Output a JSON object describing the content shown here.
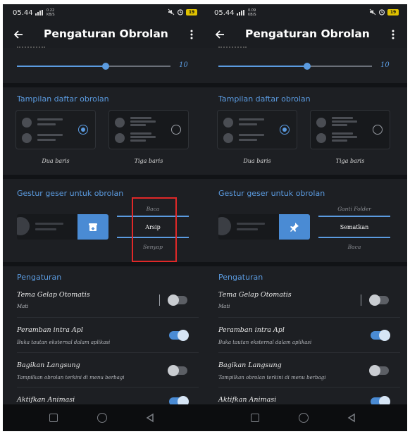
{
  "screens": [
    {
      "status": {
        "time": "05.44",
        "speed": "0.22\nKB/S",
        "battery": "19"
      },
      "title": "Pengaturan Obrolan",
      "slider_value": "10",
      "slider_level": 0.58,
      "list_section": {
        "title": "Tampilan daftar obrolan",
        "options": [
          {
            "label": "Dua baris",
            "selected": true
          },
          {
            "label": "Tiga baris",
            "selected": false
          }
        ]
      },
      "swipe_section": {
        "title": "Gestur geser untuk obrolan",
        "picker": [
          "Baca",
          "Arsip",
          "Senyap"
        ],
        "action_icon": "archive-icon"
      },
      "settings_section": {
        "title": "Pengaturan",
        "items": [
          {
            "title": "Tema Gelap Otomatis",
            "sub": "Mati",
            "on": false
          },
          {
            "title": "Peramban intra Apl",
            "sub": "Buka tautan eksternal dalam aplikasi",
            "on": true
          },
          {
            "title": "Bagikan Langsung",
            "sub": "Tampilkan obrolan terkini di menu berbagi",
            "on": false
          },
          {
            "title": "Aktifkan Animasi",
            "sub": "",
            "on": true
          }
        ]
      }
    },
    {
      "status": {
        "time": "05.44",
        "speed": "0.09\nKB/S",
        "battery": "19"
      },
      "title": "Pengaturan Obrolan",
      "slider_value": "10",
      "slider_level": 0.58,
      "list_section": {
        "title": "Tampilan daftar obrolan",
        "options": [
          {
            "label": "Dua baris",
            "selected": true
          },
          {
            "label": "Tiga baris",
            "selected": false
          }
        ]
      },
      "swipe_section": {
        "title": "Gestur geser untuk obrolan",
        "picker": [
          "Ganti Folder",
          "Sematkan",
          "Baca"
        ],
        "action_icon": "pin-icon"
      },
      "settings_section": {
        "title": "Pengaturan",
        "items": [
          {
            "title": "Tema Gelap Otomatis",
            "sub": "Mati",
            "on": false
          },
          {
            "title": "Peramban intra Apl",
            "sub": "Buka tautan eksternal dalam aplikasi",
            "on": true
          },
          {
            "title": "Bagikan Langsung",
            "sub": "Tampilkan obrolan terkini di menu berbagi",
            "on": false
          },
          {
            "title": "Aktifkan Animasi",
            "sub": "",
            "on": true
          }
        ]
      }
    }
  ],
  "colors": {
    "accent": "#5b9be0",
    "highlight": "#e02828",
    "background": "#1d1f23"
  }
}
